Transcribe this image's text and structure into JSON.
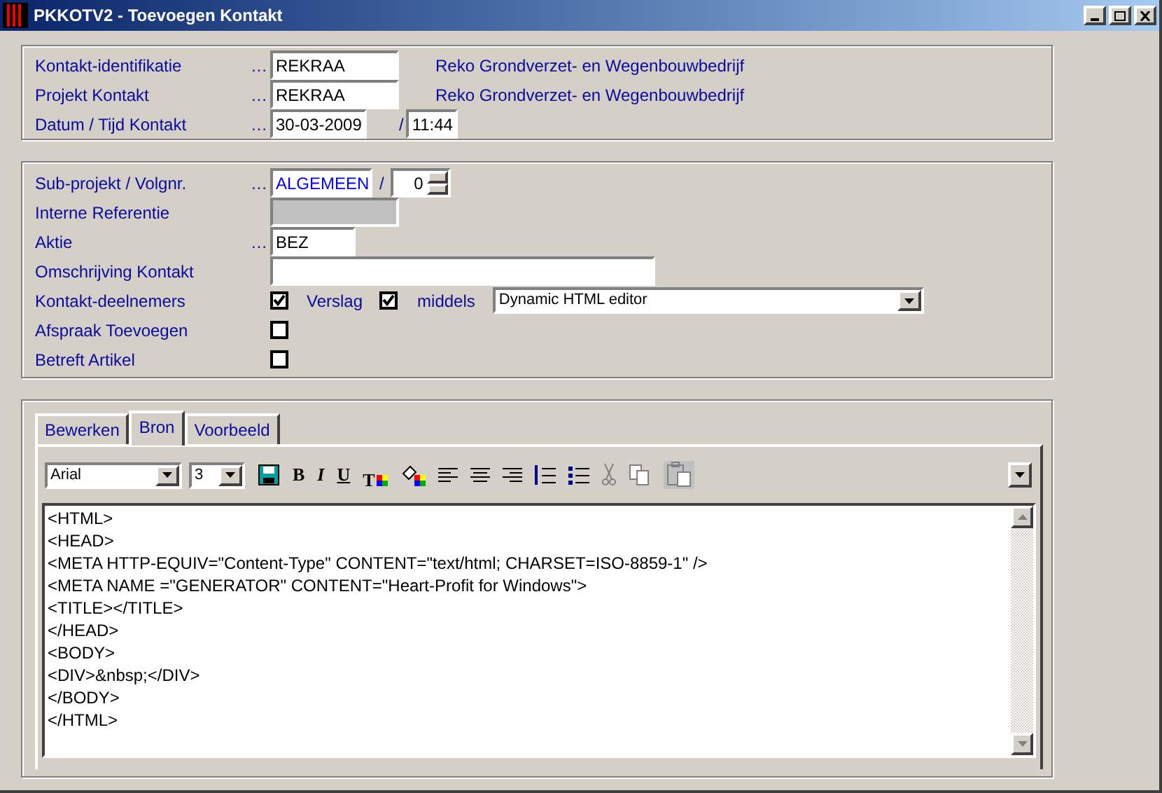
{
  "window": {
    "title": "PKKOTV2 - Toevoegen Kontakt"
  },
  "header_rows": [
    {
      "kind": "lookup",
      "label": "Kontakt-identifikatie",
      "dots": "…",
      "value": "REKRAA",
      "description": "Reko Grondverzet- en Wegenbouwbedrijf"
    },
    {
      "kind": "lookup",
      "label": "Projekt Kontakt",
      "dots": "…",
      "value": "REKRAA",
      "description": "Reko Grondverzet- en Wegenbouwbedrijf"
    },
    {
      "kind": "datetime",
      "label": "Datum / Tijd Kontakt",
      "dots": "…",
      "value": "30-03-2009",
      "separator": "/",
      "time": "11:44"
    }
  ],
  "detail_rows": [
    {
      "kind": "subproject",
      "label": "Sub-projekt / Volgnr.",
      "dots": "…",
      "value": "ALGEMEEN",
      "separator": "/",
      "number": "0"
    },
    {
      "kind": "medium",
      "label": "Interne Referentie",
      "disabled": true
    },
    {
      "kind": "short",
      "label": "Aktie",
      "dots": "…",
      "value": "BEZ",
      "disabled": false
    },
    {
      "kind": "wide",
      "label": "Omschrijving Kontakt",
      "disabled": false
    },
    {
      "kind": "checks",
      "label": "Kontakt-deelnemers",
      "checked": true,
      "report_label": "Verslag",
      "report_checked": true,
      "via_label": "middels",
      "editor": "Dynamic HTML editor"
    },
    {
      "kind": "check",
      "label": "Afspraak Toevoegen",
      "checked": false
    },
    {
      "kind": "check",
      "label": "Betreft Artikel",
      "checked": false
    }
  ],
  "tabs": [
    {
      "label": "Bewerken",
      "selected": false
    },
    {
      "label": "Bron",
      "selected": true
    },
    {
      "label": "Voorbeeld",
      "selected": false
    }
  ],
  "toolbar": {
    "font": "Arial",
    "size": "3",
    "tools": [
      {
        "kind": "save",
        "disabled": false
      },
      {
        "kind": "bold",
        "label": "B",
        "disabled": false
      },
      {
        "kind": "italic",
        "label": "I",
        "disabled": false
      },
      {
        "kind": "underline",
        "label": "U",
        "disabled": false
      },
      {
        "kind": "text-color",
        "label": "T",
        "disabled": false
      },
      {
        "kind": "fill-color",
        "disabled": false
      },
      {
        "kind": "align-left",
        "disabled": false
      },
      {
        "kind": "align-center",
        "disabled": false
      },
      {
        "kind": "align-right",
        "disabled": false
      },
      {
        "kind": "numbered-list",
        "disabled": false
      },
      {
        "kind": "bullet-list",
        "disabled": false
      },
      {
        "kind": "cut",
        "disabled": true
      },
      {
        "kind": "copy",
        "disabled": true
      },
      {
        "kind": "paste",
        "disabled": true
      }
    ]
  },
  "editor": {
    "lines": [
      "<HTML>",
      "<HEAD>",
      "<META HTTP-EQUIV=\"Content-Type\" CONTENT=\"text/html; CHARSET=ISO-8859-1\" />",
      "<META NAME =\"GENERATOR\" CONTENT=\"Heart-Profit for Windows\">",
      "<TITLE></TITLE>",
      "</HEAD>",
      "<BODY>",
      "<DIV>&nbsp;</DIV>",
      "</BODY>",
      "</HTML>"
    ]
  }
}
